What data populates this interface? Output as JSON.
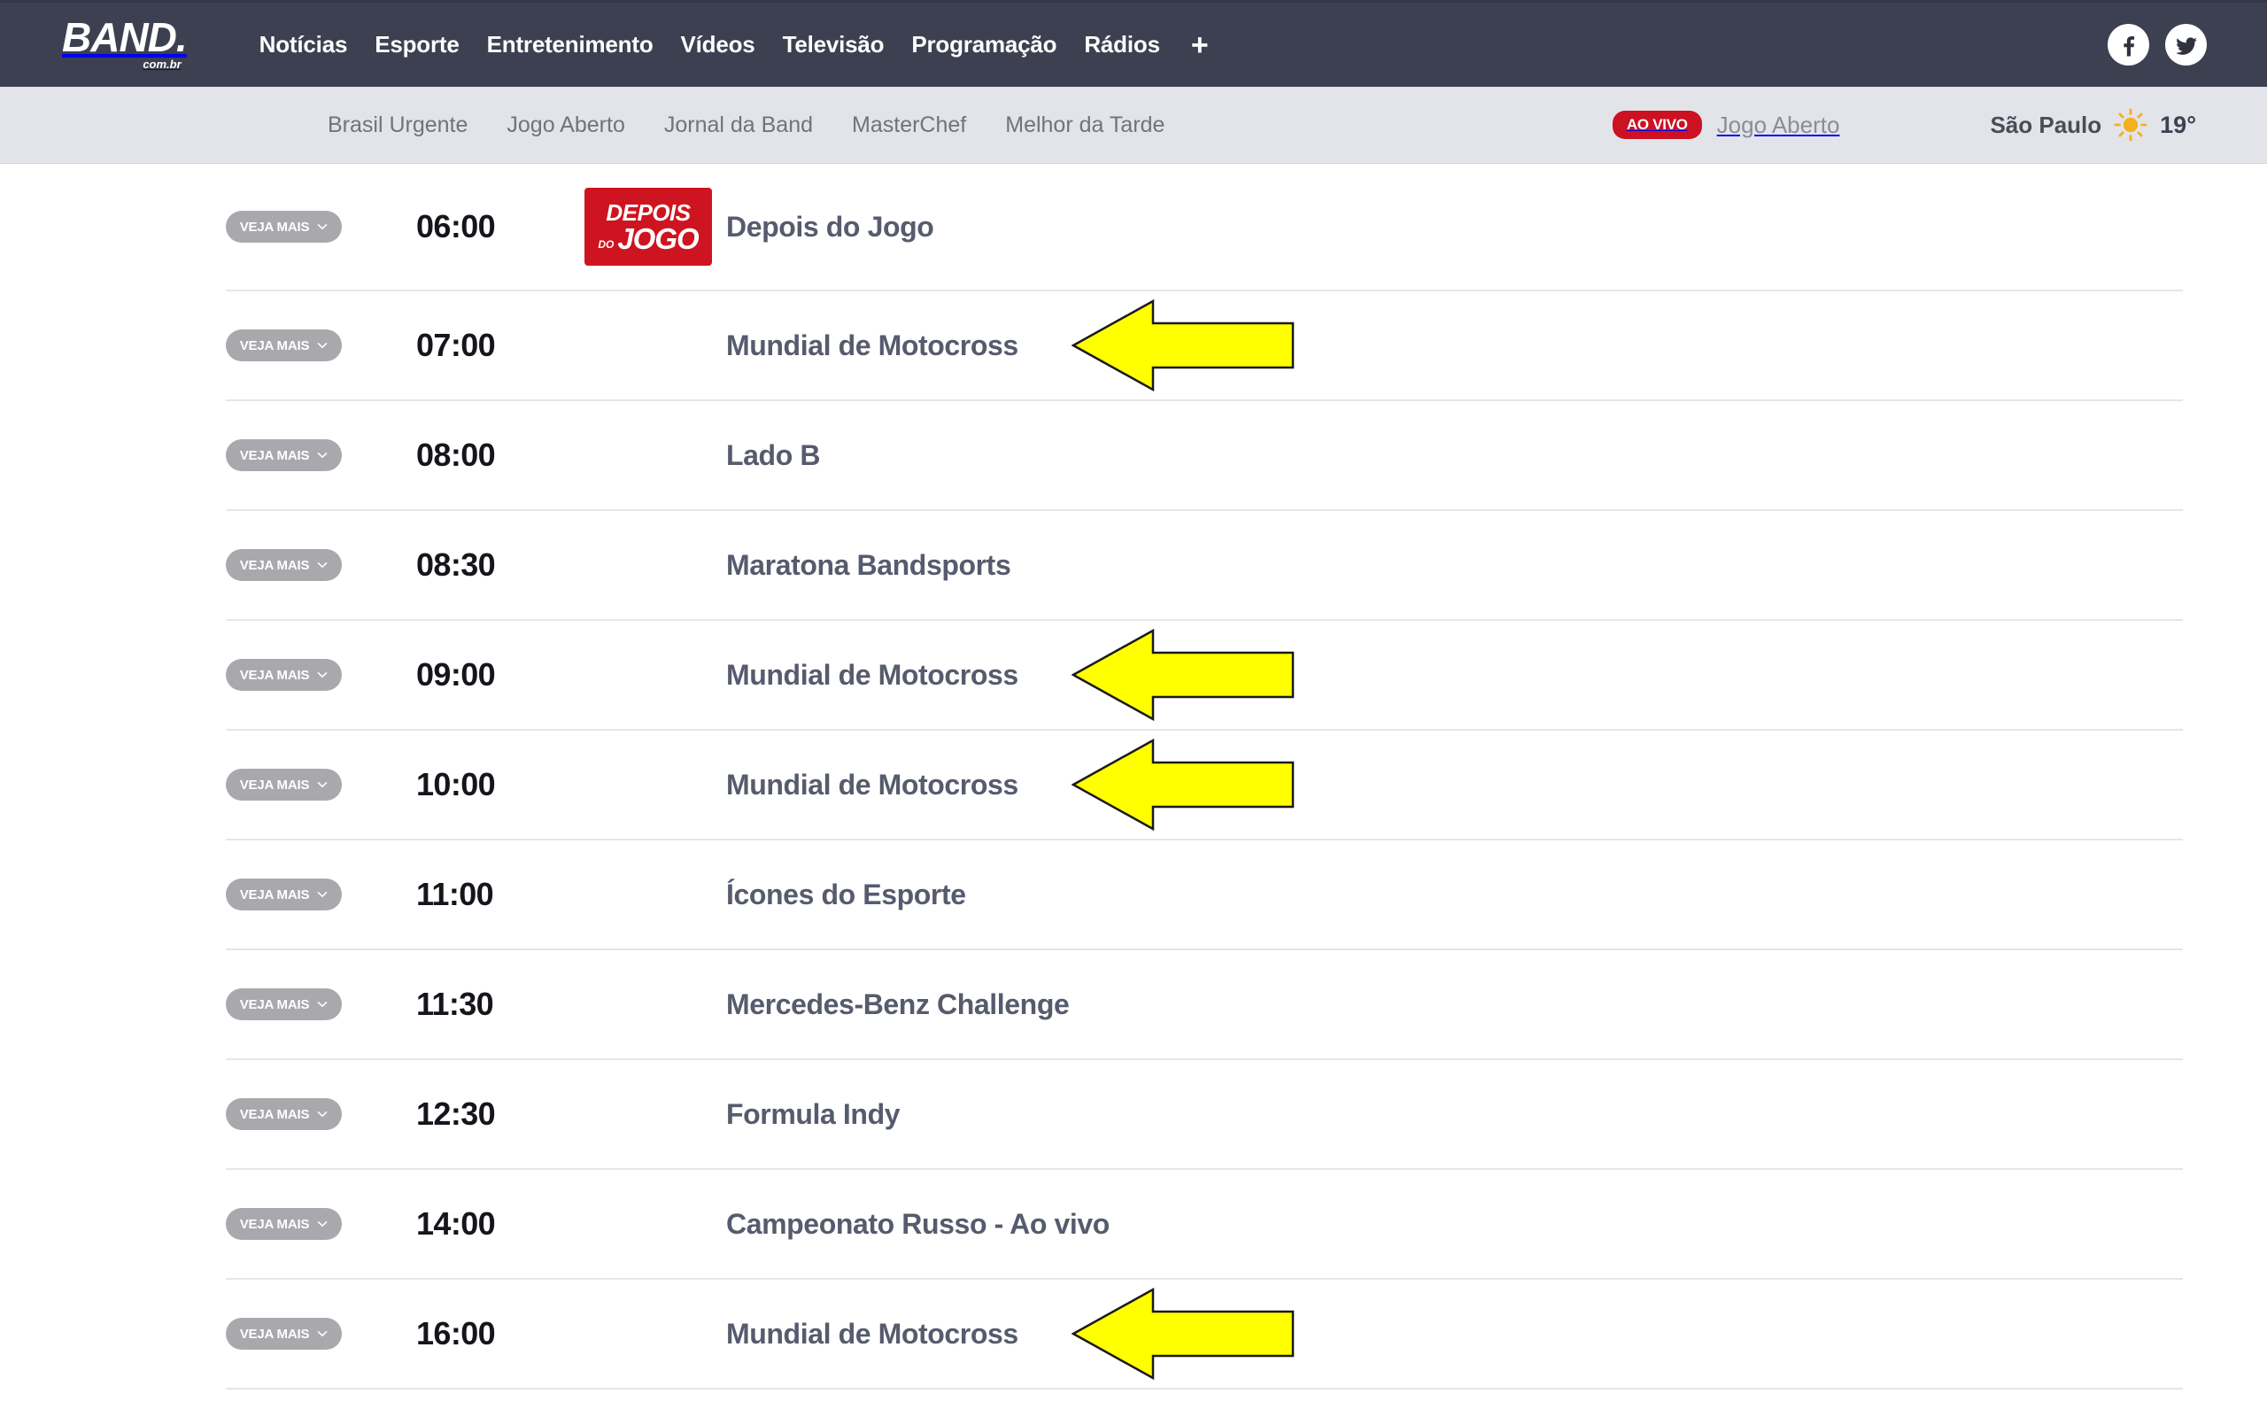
{
  "header": {
    "brand": {
      "word": "BAND.",
      "sub": "com.br"
    },
    "nav": [
      {
        "label": "Notícias"
      },
      {
        "label": "Esporte"
      },
      {
        "label": "Entretenimento"
      },
      {
        "label": "Vídeos"
      },
      {
        "label": "Televisão"
      },
      {
        "label": "Programação"
      },
      {
        "label": "Rádios"
      },
      {
        "label": "+"
      }
    ],
    "social": [
      {
        "name": "facebook-icon"
      },
      {
        "name": "twitter-icon"
      }
    ],
    "colors": {
      "bar_bg": "#3d4050",
      "text": "#ffffff"
    }
  },
  "subbar": {
    "nav": [
      {
        "label": "Brasil Urgente"
      },
      {
        "label": "Jogo Aberto"
      },
      {
        "label": "Jornal da Band"
      },
      {
        "label": "MasterChef"
      },
      {
        "label": "Melhor da Tarde"
      }
    ],
    "live": {
      "badge": "AO VIVO",
      "program": "Jogo Aberto",
      "badge_color": "#cc1122"
    },
    "weather": {
      "city": "São Paulo",
      "temperature": "19°",
      "icon": "sun-icon",
      "icon_color": "#f5b01e"
    },
    "colors": {
      "bg": "#e2e4ea",
      "link": "#70737e"
    }
  },
  "schedule": {
    "veja_mais_label": "VEJA MAIS",
    "rows": [
      {
        "time": "06:00",
        "title": "Depois do Jogo",
        "thumb": {
          "line1": "DEPOIS",
          "mid": "DO",
          "line2": "JOGO",
          "bg": "#cf1421"
        },
        "arrow": false
      },
      {
        "time": "07:00",
        "title": "Mundial de Motocross",
        "arrow": true
      },
      {
        "time": "08:00",
        "title": "Lado B",
        "arrow": false
      },
      {
        "time": "08:30",
        "title": "Maratona Bandsports",
        "arrow": false
      },
      {
        "time": "09:00",
        "title": "Mundial de Motocross",
        "arrow": true
      },
      {
        "time": "10:00",
        "title": "Mundial de Motocross",
        "arrow": true
      },
      {
        "time": "11:00",
        "title": "Ícones do Esporte",
        "arrow": false
      },
      {
        "time": "11:30",
        "title": "Mercedes-Benz Challenge",
        "arrow": false
      },
      {
        "time": "12:30",
        "title": "Formula Indy",
        "arrow": false
      },
      {
        "time": "14:00",
        "title": "Campeonato Russo - Ao vivo",
        "arrow": false
      },
      {
        "time": "16:00",
        "title": "Mundial de Motocross",
        "arrow": true
      }
    ],
    "arrow_color": "#ffff00",
    "colors": {
      "time": "#14161c",
      "title": "#565b6d",
      "pill": "#a9a9ad",
      "divider": "#e6e6e6"
    }
  }
}
